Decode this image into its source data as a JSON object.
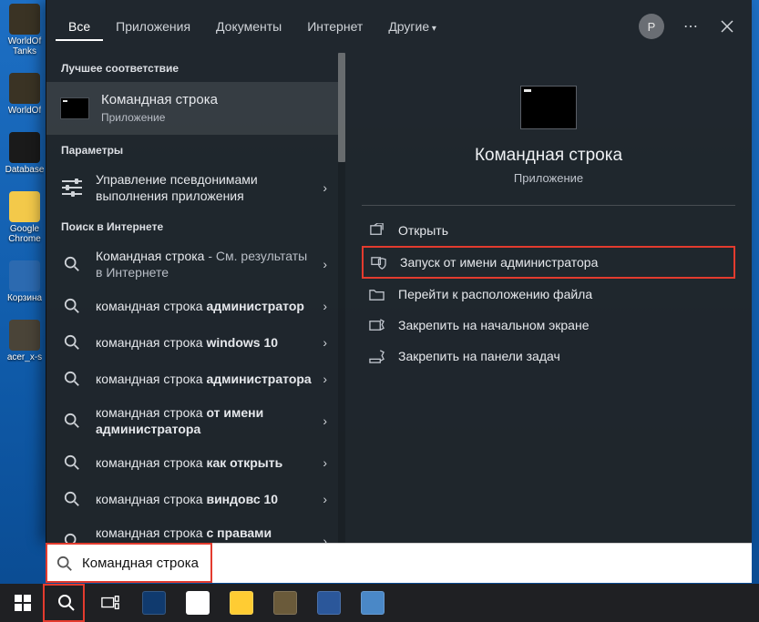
{
  "desktop_icons": [
    {
      "label": "WorldOf Tanks",
      "bg": "#3a3324"
    },
    {
      "label": "WorldOf",
      "bg": "#3a3324"
    },
    {
      "label": "Database",
      "bg": "#1a1a1a"
    },
    {
      "label": "Google Chrome",
      "bg": "#f3c94a"
    },
    {
      "label": "Корзина",
      "bg": "#2c6ab0"
    },
    {
      "label": "acer_x-s",
      "bg": "#4a4438"
    }
  ],
  "header": {
    "tabs": [
      "Все",
      "Приложения",
      "Документы",
      "Интернет",
      "Другие"
    ],
    "active_index": 0,
    "avatar_initial": "P"
  },
  "left": {
    "best_match_label": "Лучшее соответствие",
    "best_match": {
      "title": "Командная строка",
      "sub": "Приложение"
    },
    "params_label": "Параметры",
    "params_item_plain": "Управление псевдонимами выполнения приложения",
    "web_label": "Поиск в Интернете",
    "web_suggestions": [
      {
        "pre": "Командная строка",
        "suf": " - См. результаты в Интернете",
        "bold": ""
      },
      {
        "pre": "командная строка ",
        "suf": "",
        "bold": "администратор"
      },
      {
        "pre": "командная строка ",
        "suf": "",
        "bold": "windows 10"
      },
      {
        "pre": "командная строка ",
        "suf": "",
        "bold": "администратора"
      },
      {
        "pre": "командная строка ",
        "suf": "",
        "bold": "от имени администратора"
      },
      {
        "pre": "командная строка ",
        "suf": "",
        "bold": "как открыть"
      },
      {
        "pre": "командная строка ",
        "suf": "",
        "bold": "виндовс 10"
      },
      {
        "pre": "командная строка ",
        "suf": "",
        "bold": "с правами администратора"
      }
    ]
  },
  "preview": {
    "title": "Командная строка",
    "sub": "Приложение",
    "actions": [
      {
        "label": "Открыть",
        "icon": "open"
      },
      {
        "label": "Запуск от имени администратора",
        "icon": "shield",
        "highlight": true
      },
      {
        "label": "Перейти к расположению файла",
        "icon": "folder"
      },
      {
        "label": "Закрепить на начальном экране",
        "icon": "pin-start"
      },
      {
        "label": "Закрепить на панели задач",
        "icon": "pin-task"
      }
    ]
  },
  "search_value": "Командная строка",
  "taskbar_icons": [
    {
      "name": "taskview-icon",
      "bg": "transparent"
    },
    {
      "name": "movies-icon",
      "bg": "#103a6e"
    },
    {
      "name": "chrome-icon",
      "bg": "#fff"
    },
    {
      "name": "explorer-icon",
      "bg": "#ffcc33"
    },
    {
      "name": "app1-icon",
      "bg": "#6a5a3a"
    },
    {
      "name": "word-icon",
      "bg": "#2b579a"
    },
    {
      "name": "app2-icon",
      "bg": "#4a88c7"
    }
  ]
}
